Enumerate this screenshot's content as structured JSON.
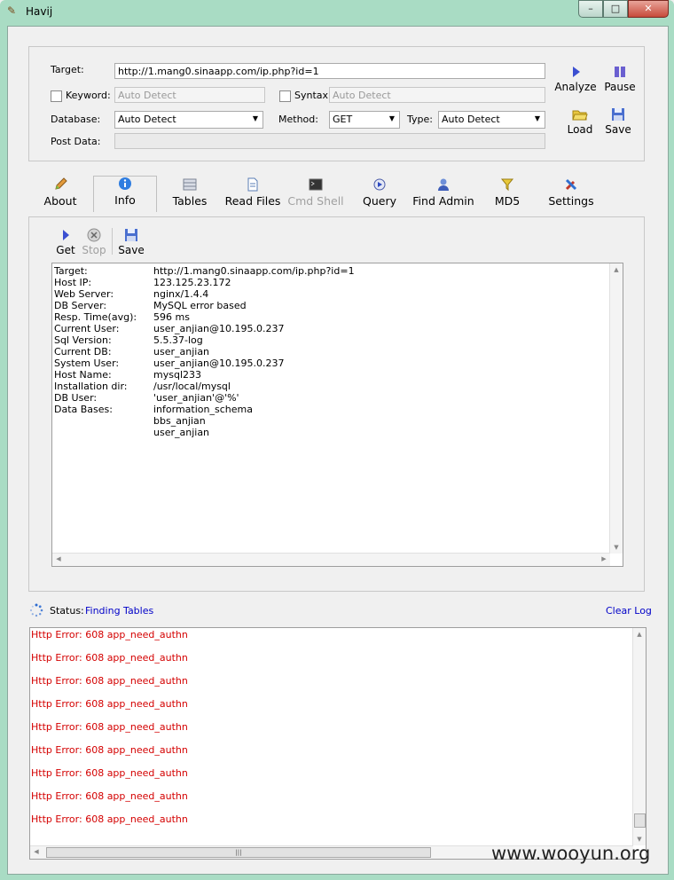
{
  "window": {
    "title": "Havij",
    "minimize": "–",
    "maximize": "□",
    "close": "✕"
  },
  "form": {
    "target_label": "Target:",
    "target_value": "http://1.mang0.sinaapp.com/ip.php?id=1",
    "keyword_label": "Keyword:",
    "keyword_placeholder": "Auto Detect",
    "syntax_label": "Syntax:",
    "syntax_placeholder": "Auto Detect",
    "database_label": "Database:",
    "database_value": "Auto Detect",
    "method_label": "Method:",
    "method_value": "GET",
    "type_label": "Type:",
    "type_value": "Auto Detect",
    "postdata_label": "Post Data:",
    "postdata_value": ""
  },
  "actions": {
    "analyze": "Analyze",
    "pause": "Pause",
    "load": "Load",
    "save": "Save"
  },
  "tabs": [
    {
      "label": "About",
      "icon": "pencil-icon"
    },
    {
      "label": "Info",
      "icon": "info-icon"
    },
    {
      "label": "Tables",
      "icon": "table-icon"
    },
    {
      "label": "Read Files",
      "icon": "file-icon"
    },
    {
      "label": "Cmd Shell",
      "icon": "terminal-icon"
    },
    {
      "label": "Query",
      "icon": "query-icon"
    },
    {
      "label": "Find Admin",
      "icon": "admin-icon"
    },
    {
      "label": "MD5",
      "icon": "key-icon"
    },
    {
      "label": "Settings",
      "icon": "tools-icon"
    }
  ],
  "info_toolbar": {
    "get": "Get",
    "stop": "Stop",
    "save": "Save"
  },
  "info": [
    {
      "key": "Target:",
      "value": "http://1.mang0.sinaapp.com/ip.php?id=1"
    },
    {
      "key": "Host IP:",
      "value": "123.125.23.172"
    },
    {
      "key": "Web Server:",
      "value": "nginx/1.4.4"
    },
    {
      "key": "DB Server:",
      "value": "MySQL error based"
    },
    {
      "key": "Resp. Time(avg):",
      "value": "596 ms"
    },
    {
      "key": "Current User:",
      "value": "user_anjian@10.195.0.237"
    },
    {
      "key": "Sql Version:",
      "value": "5.5.37-log"
    },
    {
      "key": "Current DB:",
      "value": "user_anjian"
    },
    {
      "key": "System User:",
      "value": "user_anjian@10.195.0.237"
    },
    {
      "key": "Host Name:",
      "value": "mysql233"
    },
    {
      "key": "Installation dir:",
      "value": "/usr/local/mysql"
    },
    {
      "key": "DB User:",
      "value": "'user_anjian'@'%'"
    },
    {
      "key": "Data Bases:",
      "value": "information_schema"
    },
    {
      "key": "",
      "value": "bbs_anjian"
    },
    {
      "key": "",
      "value": "user_anjian"
    }
  ],
  "status": {
    "label": "Status:",
    "value": "Finding Tables",
    "clear_log": "Clear Log"
  },
  "log": [
    "Http Error: 608 app_need_authn",
    "Http Error: 608 app_need_authn",
    "Http Error: 608 app_need_authn",
    "Http Error: 608 app_need_authn",
    "Http Error: 608 app_need_authn",
    "Http Error: 608 app_need_authn",
    "Http Error: 608 app_need_authn",
    "Http Error: 608 app_need_authn",
    "Http Error: 608 app_need_authn"
  ],
  "watermark": "www.wooyun.org",
  "colors": {
    "error": "#d40000",
    "link": "#0000c8",
    "frame": "#a9dcc4"
  }
}
